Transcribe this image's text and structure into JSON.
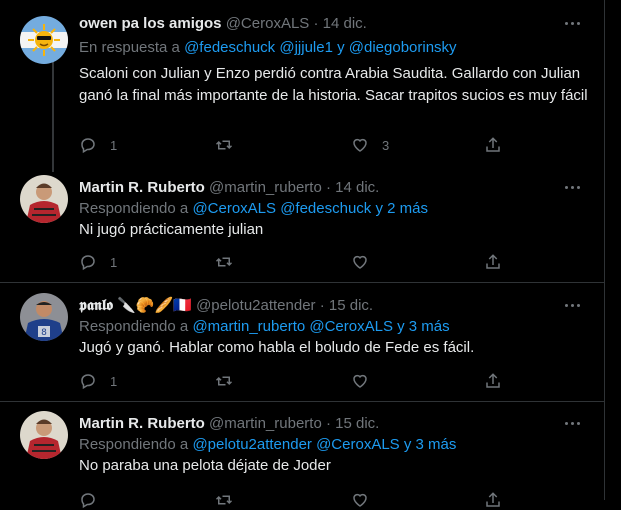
{
  "thread": [
    {
      "author": "owen pa los amigos",
      "handle": "@CeroxALS",
      "sep": "·",
      "date": "14 dic.",
      "reply_prefix": "En respuesta a",
      "reply_targets": "@fedeschuck @jjjule1 y @diegoborinsky",
      "text": "Scaloni con Julian y Enzo perdió contra Arabia Saudita. Gallardo con Julian ganó la final más importante de la historia. Sacar trapitos sucios es muy fácil",
      "reply_count": "1",
      "retweet_count": "",
      "like_count": "3",
      "avatar": "sun-flag-avatar"
    },
    {
      "author": "Martin R. Ruberto",
      "handle": "@martin_ruberto",
      "sep": "·",
      "date": "14 dic.",
      "reply_prefix": "Respondiendo a",
      "reply_targets": "@CeroxALS @fedeschuck y 2 más",
      "text": "Ni jugó prácticamente julian",
      "reply_count": "1",
      "retweet_count": "",
      "like_count": "",
      "avatar": "person-avatar"
    },
    {
      "author": "𝖕𝖆𝖓𝖑𝖔",
      "author_emoji": "🔪🥐🥖🇫🇷",
      "handle": "@pelotu2attender",
      "sep": "·",
      "date": "15 dic.",
      "reply_prefix": "Respondiendo a",
      "reply_targets": "@martin_ruberto @CeroxALS y 3 más",
      "text": "Jugó y ganó. Hablar como habla el boludo de Fede es fácil.",
      "reply_count": "1",
      "retweet_count": "",
      "like_count": "",
      "avatar": "player-avatar"
    },
    {
      "author": "Martin R. Ruberto",
      "handle": "@martin_ruberto",
      "sep": "·",
      "date": "15 dic.",
      "reply_prefix": "Respondiendo a",
      "reply_targets": "@pelotu2attender @CeroxALS y 3 más",
      "text": "No paraba una pelota déjate de Joder",
      "reply_count": "",
      "retweet_count": "",
      "like_count": "",
      "avatar": "person-avatar"
    }
  ],
  "colors": {
    "background": "#000000",
    "text": "#e7e9ea",
    "muted": "#71767b",
    "link": "#1d9bf0",
    "border": "#2f3336"
  },
  "icons": [
    "more-icon",
    "reply-icon",
    "retweet-icon",
    "like-icon",
    "share-icon"
  ]
}
